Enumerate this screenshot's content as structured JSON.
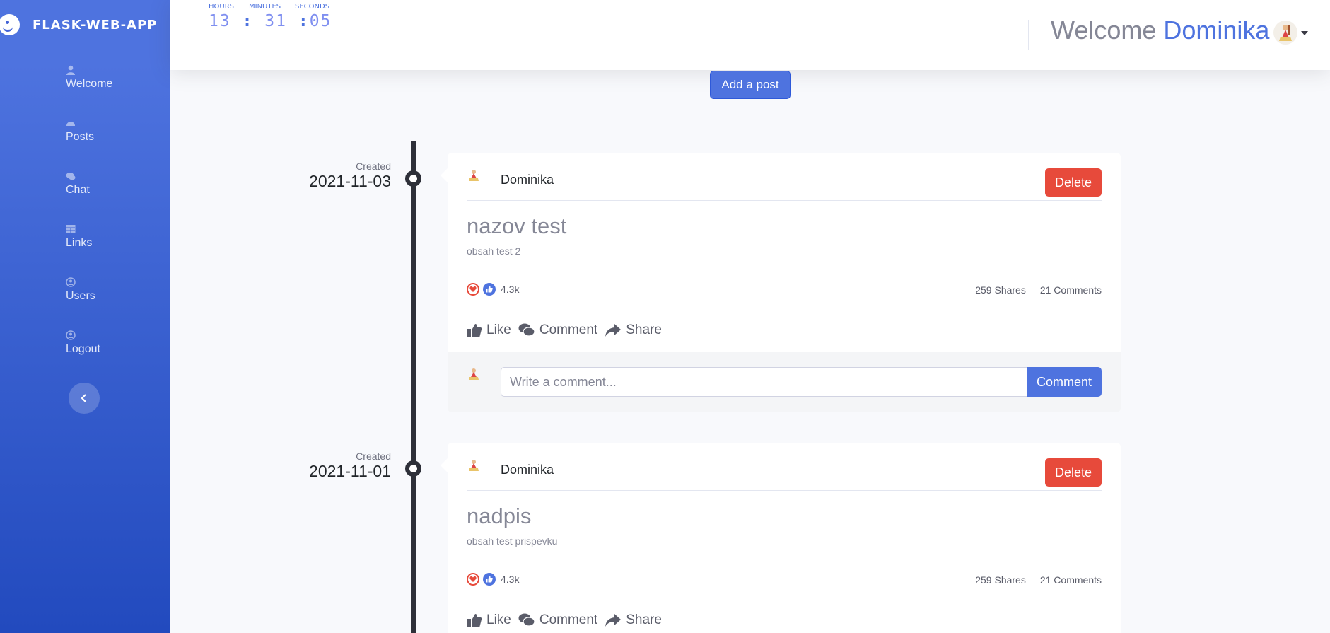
{
  "brand": {
    "name": "FLASK-WEB-APP"
  },
  "sidebar": {
    "items": [
      {
        "label": "Welcome",
        "icon": "user-icon"
      },
      {
        "label": "Posts",
        "icon": "tachometer-icon"
      },
      {
        "label": "Chat",
        "icon": "comments-icon"
      },
      {
        "label": "Links",
        "icon": "table-icon"
      },
      {
        "label": "Users",
        "icon": "user-circle-icon"
      },
      {
        "label": "Logout",
        "icon": "user-circle-icon"
      }
    ],
    "toggle_icon": "chevron-left-icon"
  },
  "clock": {
    "hours_label": "HOURS",
    "minutes_label": "MINUTES",
    "seconds_label": "SECONDS",
    "hours": "13",
    "minutes": "31",
    "seconds": "05"
  },
  "header": {
    "welcome_text": "Welcome",
    "user_name": "Dominika"
  },
  "add_post_label": "Add a post",
  "posts": [
    {
      "created_label": "Created",
      "date": "2021-11-03",
      "author": "Dominika",
      "delete_label": "Delete",
      "title": "nazov test",
      "content": "obsah test 2",
      "reaction_count": "4.3k",
      "shares": "259 Shares",
      "comments": "21 Comments",
      "like_label": "Like",
      "comment_label": "Comment",
      "share_label": "Share",
      "comment_placeholder": "Write a comment...",
      "comment_button": "Comment"
    },
    {
      "created_label": "Created",
      "date": "2021-11-01",
      "author": "Dominika",
      "delete_label": "Delete",
      "title": "nadpis",
      "content": "obsah test prispevku",
      "reaction_count": "4.3k",
      "shares": "259 Shares",
      "comments": "21 Comments",
      "like_label": "Like",
      "comment_label": "Comment",
      "share_label": "Share"
    }
  ],
  "colors": {
    "primary": "#4e73df",
    "danger": "#e74a3b",
    "background": "#f8f9fc"
  }
}
